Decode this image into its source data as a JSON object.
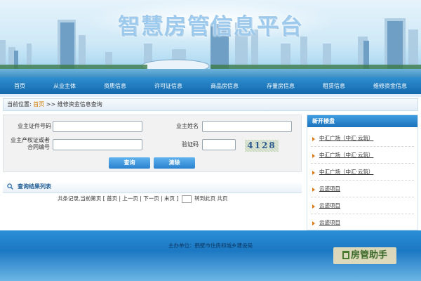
{
  "header": {
    "title": "智慧房管信息平台"
  },
  "nav": {
    "items": [
      "首页",
      "从业主体",
      "资质信息",
      "许可证信息",
      "商品房信息",
      "存量房信息",
      "租赁信息",
      "维修资金信息"
    ]
  },
  "breadcrumb": {
    "prefix": "当前位置:",
    "home": "首页",
    "sep": ">>",
    "current": "维修资金信息查询"
  },
  "form": {
    "owner_id_label": "业主证件号码",
    "owner_id_value": "",
    "owner_name_label": "业主姓名",
    "owner_name_value": "",
    "contract_label_line1": "业主产权证或者",
    "contract_label_line2": "合同编号",
    "contract_value": "",
    "captcha_label": "验证码",
    "captcha_value": "",
    "captcha_text": "4128",
    "query_button": "查询",
    "clear_button": "清除"
  },
  "results": {
    "title": "查询结果列表",
    "pager": {
      "summary": "共条记录,当前第页 [",
      "first": "首页",
      "prev": "上一页",
      "next": "下一页",
      "last": "末页",
      "close": "]",
      "goto_suffix": "转到此页 共页",
      "bar": "|"
    }
  },
  "sidebar": {
    "title": "新开楼盘",
    "items": [
      "中汇广场（中汇·云筑）",
      "中汇广场（中汇·云筑）",
      "中汇广场（中汇·云筑）",
      "云迹项目",
      "云迹项目",
      "云迹项目"
    ]
  },
  "footer": {
    "sponsor": "主办单位：鹤壁市住房和城乡建设局"
  },
  "watermark": {
    "text": "房管助手"
  },
  "colors": {
    "nav": "#1e7bc2",
    "accent": "#d27a00",
    "button": "#3a90d8"
  }
}
